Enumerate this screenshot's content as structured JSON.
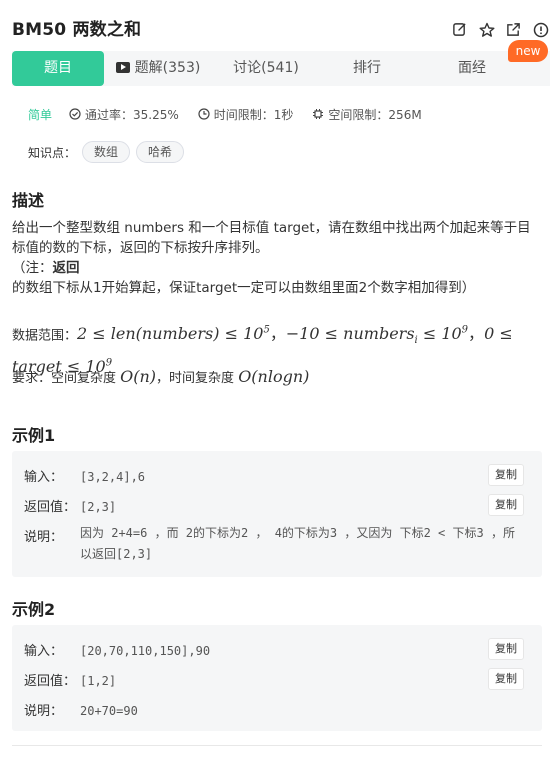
{
  "header": {
    "title": "BM50  两数之和",
    "icons": [
      "edit-icon",
      "star-icon",
      "share-icon",
      "info-icon"
    ],
    "badge": "new"
  },
  "tabs": [
    {
      "label": "题目",
      "active": true
    },
    {
      "label": "题解(353)",
      "icon": "video-icon"
    },
    {
      "label": "讨论(541)"
    },
    {
      "label": "排行"
    },
    {
      "label": "面经"
    }
  ],
  "meta": {
    "difficulty": "简单",
    "pass_rate": "通过率：35.25%",
    "time_limit": "时间限制：1秒",
    "space_limit": "空间限制：256M"
  },
  "knowledge": {
    "label": "知识点：",
    "tags": [
      "数组",
      "哈希"
    ]
  },
  "description": {
    "heading": "描述",
    "line1": "给出一个整型数组 numbers 和一个目标值 target，请在数组中找出两个加起来等于目标值的数的下标，返回的下标按升序排列。",
    "note_prefix": "（注：",
    "note_bold": "返回",
    "note_rest": "的数组下标从1开始算起，保证target一定可以由数组里面2个数字相加得到）",
    "range_label": "数据范围：",
    "range_math_1": "2 ≤ len(numbers) ≤ 10",
    "range_exp_1": "5",
    "range_math_2": "−10 ≤ numbers",
    "range_sub_2": "i",
    "range_math_2b": " ≤ 10",
    "range_exp_2": "9",
    "range_math_3": "0 ≤",
    "range_math_3b": "target ≤ 10",
    "range_exp_3": "9",
    "req_label": "要求：空间复杂度 ",
    "req_space": "O(n)",
    "req_mid": "，时间复杂度 ",
    "req_time": "O(nlogn)"
  },
  "example1": {
    "heading": "示例1",
    "input_label": "输入：",
    "input_value": "[3,2,4],6",
    "output_label": "返回值：",
    "output_value": "[2,3]",
    "explain_label": "说明：",
    "explain_value": "因为 2+4=6 ，而 2的下标为2 ， 4的下标为3 ，又因为 下标2 < 下标3 ，所以返回[2,3]",
    "copy": "复制"
  },
  "example2": {
    "heading": "示例2",
    "input_label": "输入：",
    "input_value": "[20,70,110,150],90",
    "output_label": "返回值：",
    "output_value": "[1,2]",
    "explain_label": "说明：",
    "explain_value": "20+70=90",
    "copy": "复制"
  },
  "colors": {
    "accent": "#32ca99",
    "badge": "#ff6a26",
    "panel": "#f5f6f7"
  }
}
